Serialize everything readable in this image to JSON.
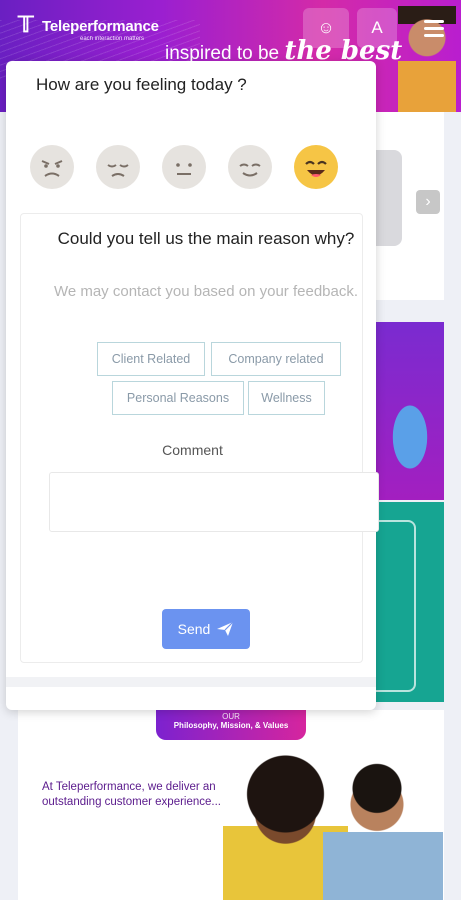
{
  "header": {
    "brand": "Teleperformance",
    "brand_sub": "each interaction matters",
    "tagline_prefix": "inspired to be",
    "tagline_emphasis": "the best",
    "avatar_letter": "A"
  },
  "background": {
    "pill_top": "OUR",
    "pill_main": "Philosophy, Mission, & Values",
    "promo_text": "At Teleperformance, we deliver an outstanding customer experience..."
  },
  "modal": {
    "title": "How are you feeling today ?",
    "moods": [
      {
        "name": "angry",
        "selected": false
      },
      {
        "name": "sad",
        "selected": false
      },
      {
        "name": "neutral",
        "selected": false
      },
      {
        "name": "content",
        "selected": false
      },
      {
        "name": "happy",
        "selected": true
      }
    ],
    "reason_title": "Could you tell us the main reason why?",
    "reason_subtitle": "We may contact you based on your feedback.",
    "tags": {
      "client": "Client Related",
      "company": "Company related",
      "personal": "Personal Reasons",
      "wellness": "Wellness"
    },
    "comment_label": "Comment",
    "comment_value": "",
    "send_label": "Send"
  },
  "colors": {
    "header_gradient_start": "#6a1fc2",
    "header_gradient_end": "#d42aa8",
    "send_button": "#6b93f0",
    "selected_mood": "#f6c545",
    "teal_tile": "#16a592"
  }
}
